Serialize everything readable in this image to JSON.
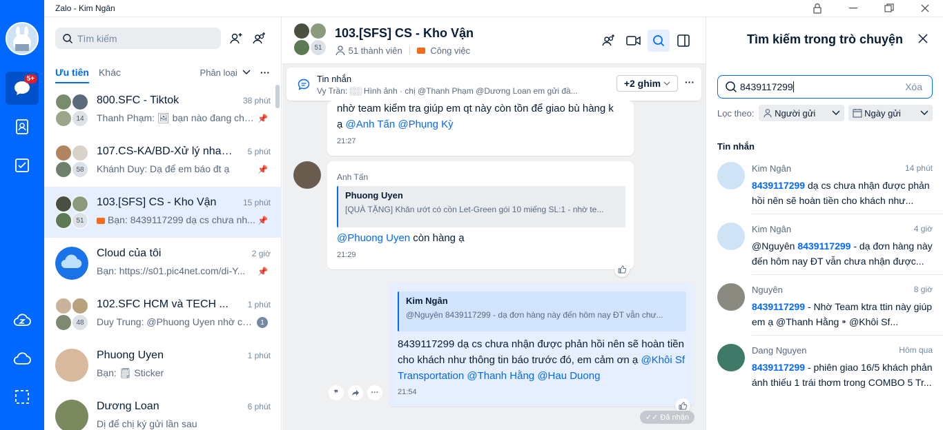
{
  "app": {
    "title": "Zalo - Kim Ngân"
  },
  "nav": {
    "badge": "5+"
  },
  "left": {
    "search_placeholder": "Tìm kiếm",
    "tabs": [
      "Ưu tiên",
      "Khác"
    ],
    "filter": "Phân loại",
    "conversations": [
      {
        "name": "800.SFC - Tiktok",
        "time": "38 phút",
        "preview": "Thanh Phạm: 🖼 bạn nào đang cha...",
        "count": "14",
        "pinned": true
      },
      {
        "name": "107.CS-KA/BD-Xử lý nhanh ...",
        "time": "5 phút",
        "preview": "Khánh Duy: Dạ để em báo đt ạ",
        "count": "58",
        "pinned": true
      },
      {
        "name": "103.[SFS] CS - Kho Vận",
        "time": "15 phút",
        "preview": "Bạn: 8439117299 dạ cs chưa nh...",
        "count": "51",
        "pinned": true,
        "active": true
      },
      {
        "name": "Cloud của tôi",
        "time": "2 giờ",
        "preview": "Bạn: https://s01.pic4net.com/di-Y...",
        "pinned": true
      },
      {
        "name": "102.SFC HCM và TECH ...",
        "time": "1 phút",
        "preview": "Duy Trung: @Phuong Uyen nhờ ch...",
        "count": "48",
        "unread": "1"
      },
      {
        "name": "Phuong Uyen",
        "time": "1 phút",
        "preview": "Bạn: 🗒 Sticker"
      },
      {
        "name": "Dương Loan",
        "time": "6 phút",
        "preview": "Dị để chị ký gửi lần sau"
      }
    ]
  },
  "chat": {
    "name": "103.[SFS] CS - Kho Vận",
    "members": "51 thành viên",
    "label": "Công việc",
    "avatar_count": "51",
    "pinned": {
      "title": "Tin nhắn",
      "preview": "Vy Trần: ░░ Hình ảnh · chị @Thanh Phạm @Dương Loan em gửi đầ...",
      "more": "+2 ghim"
    },
    "msg1": {
      "line1": "nhờ team kiểm tra giúp em qt này còn tồn để giao bù hàng k",
      "line2_pre": "ạ ",
      "mention1": "@Anh Tấn",
      "mention2": "@Phụng Kỳ",
      "time": "21:27"
    },
    "msg2": {
      "sender": "Anh Tấn",
      "quote_name": "Phuong Uyen",
      "quote_text": "[QUÀ TẶNG] Khăn ướt có cồn Let-Green gói 10 miếng SL:1 - nhờ te...",
      "mention": "@Phuong Uyen",
      "text": " còn hàng ạ",
      "time": "21:29"
    },
    "msg3": {
      "quote_name": "Kim Ngân",
      "quote_text": "@Nguyên 8439117299 - dạ đơn hàng này đến hôm nay ĐT vẫn chư...",
      "line1": "8439117299 dạ cs chưa nhận được phản hồi nên sẽ hoàn tiền",
      "line2": "cho khách như thông tin báo trước đó, em cảm ơn ạ ",
      "mention1": "@Khôi Sf",
      "line3_m1": "Transportation",
      "line3_m2": "@Thanh Hằng",
      "line3_m3": "@Hau Duong",
      "time": "21:54"
    },
    "received": "Đã nhận"
  },
  "right": {
    "title": "Tìm kiếm trong trò chuyện",
    "query": "8439117299",
    "clear": "Xóa",
    "filter_label": "Lọc theo:",
    "filter_sender": "Người gửi",
    "filter_date": "Ngày gửi",
    "section": "Tin nhắn",
    "results": [
      {
        "name": "Kim Ngân",
        "time": "14 phút",
        "pre": "",
        "hl": "8439117299",
        "post": " dạ cs chưa nhận được phản hồi nên sẽ hoàn tiền cho khách như..."
      },
      {
        "name": "Kim Ngân",
        "time": "4 giờ",
        "pre": "@Nguyên ",
        "hl": "8439117299",
        "post": " - dạ đơn hàng này đến hôm nay ĐT vẫn chưa nhận được..."
      },
      {
        "name": "Nguyên",
        "time": "8 giờ",
        "pre": "",
        "hl": "8439117299",
        "post": " - Nhờ Team ktra ttin này giúp em ạ @Thanh Hằng ⁍ @Khôi Sf..."
      },
      {
        "name": "Dang Nguyen",
        "time": "Hôm qua",
        "pre": "",
        "hl": "8439117299",
        "post": " - phiên giao 16/5 khách phản ánh thiếu 1 trái thơm trong COMBO 5 Tr..."
      }
    ]
  }
}
